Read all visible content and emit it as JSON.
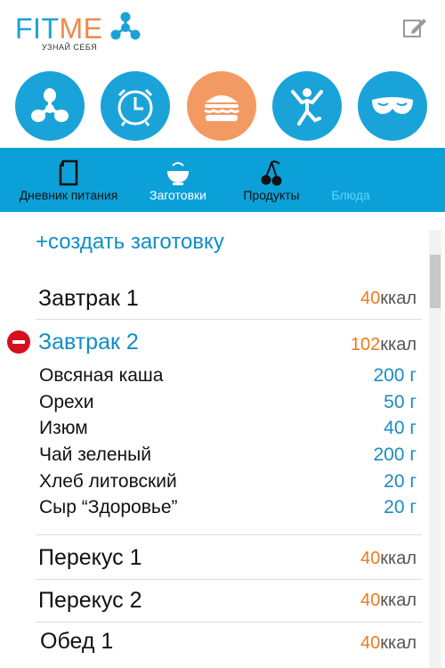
{
  "header": {
    "logo_fit": "FIT",
    "logo_me": "ME",
    "tagline": "УЗНАЙ СЕБЯ",
    "edit_icon": "edit-icon"
  },
  "categories": [
    {
      "icon": "network-icon",
      "active": false
    },
    {
      "icon": "alarm-clock-icon",
      "active": false
    },
    {
      "icon": "burger-icon",
      "active": true
    },
    {
      "icon": "person-jumping-icon",
      "active": false
    },
    {
      "icon": "sleep-mask-icon",
      "active": false
    }
  ],
  "tabs": [
    {
      "label": "Дневник питания",
      "icon": "document-icon",
      "active": false
    },
    {
      "label": "Заготовки",
      "icon": "bowl-icon",
      "active": false
    },
    {
      "label": "Продукты",
      "icon": "cherry-icon",
      "active": false
    },
    {
      "label": "Блюда",
      "active": true
    }
  ],
  "colors": {
    "accent_blue": "#1aa3d9",
    "accent_orange": "#f39a63",
    "tab_bar": "#0ca0d8",
    "kcal_number": "#f07a1e",
    "delete_red": "#d4101e"
  },
  "create_label": "+создать заготовку",
  "meals": [
    {
      "name": "Завтрак 1",
      "kcal": "40",
      "unit": "ккал"
    },
    {
      "name": "Завтрак 2",
      "kcal": "102",
      "unit": "ккал",
      "expanded": true,
      "items": [
        {
          "name": "Овсяная каша",
          "amount": "200 г"
        },
        {
          "name": "Орехи",
          "amount": "50 г"
        },
        {
          "name": "Изюм",
          "amount": "40 г"
        },
        {
          "name": "Чай зеленый",
          "amount": "200 г"
        },
        {
          "name": "Хлеб литовский",
          "amount": "20 г"
        },
        {
          "name": "Сыр “Здоровье”",
          "amount": "20 г"
        }
      ]
    },
    {
      "name": "Перекус 1",
      "kcal": "40",
      "unit": "ккал"
    },
    {
      "name": "Перекус 2",
      "kcal": "40",
      "unit": "ккал"
    },
    {
      "name": "Обед 1",
      "kcal": "40",
      "unit": "ккал"
    }
  ]
}
